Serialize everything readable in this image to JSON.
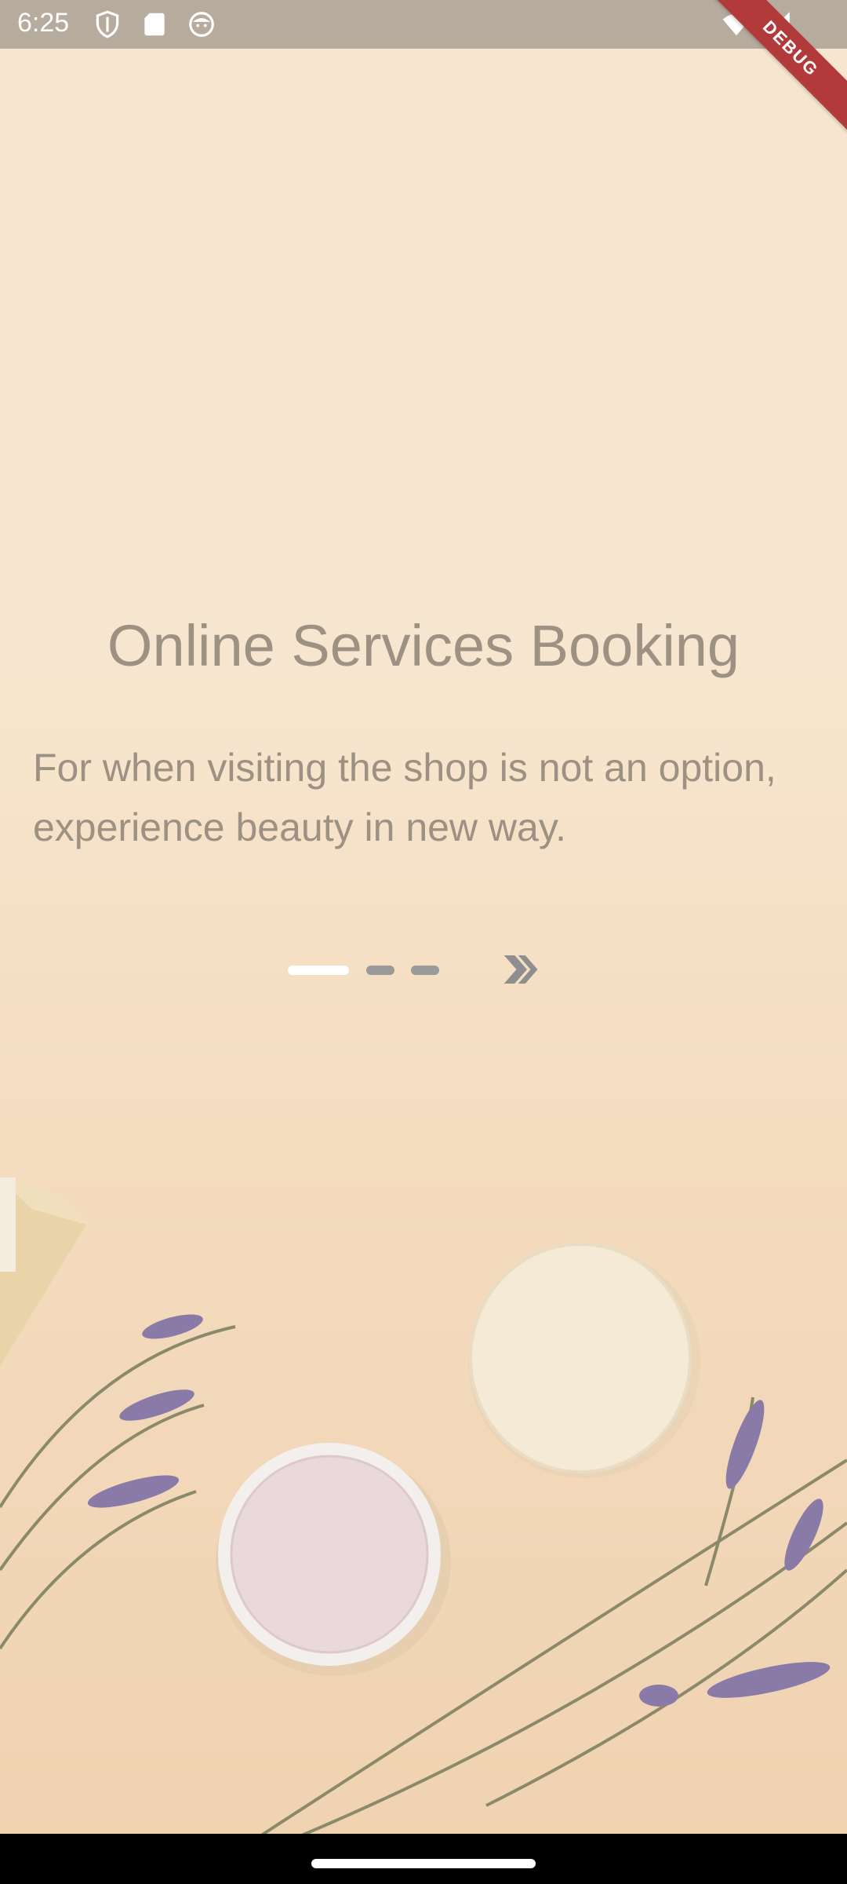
{
  "status_bar": {
    "time": "6:25",
    "left_icons": [
      "shield-icon",
      "sd-card-icon",
      "face-icon"
    ],
    "right_icons": [
      "wifi-icon",
      "signal-icon"
    ]
  },
  "debug_banner": "DEBUG",
  "onboarding": {
    "title": "Online Services Booking",
    "description": "For when visiting the shop is not an option, experience beauty in new way.",
    "page_indicator": {
      "total": 3,
      "current": 1
    },
    "next_icon": "double-chevron-right-icon"
  },
  "colors": {
    "background": "#f6e6d0",
    "text": "#9c9183",
    "indicator_active": "#ffffff",
    "indicator_inactive": "#9a9a9a",
    "debug_ribbon": "#b33a3a"
  }
}
